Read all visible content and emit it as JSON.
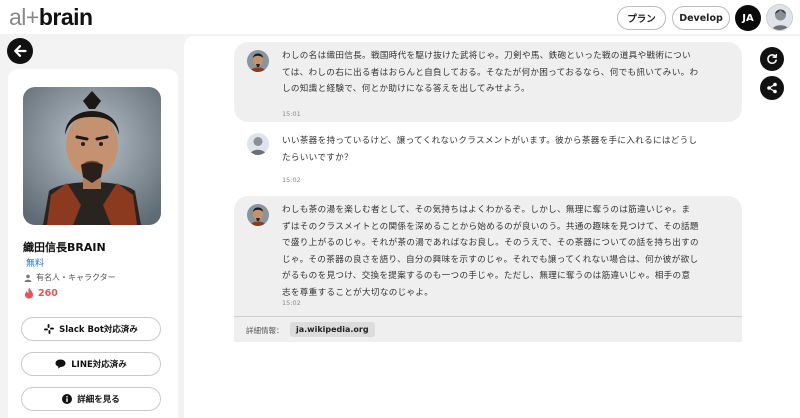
{
  "header": {
    "logo_prefix": "al+",
    "logo_main": "brain",
    "plan_label": "プラン",
    "develop_label": "Develop",
    "lang_label": "JA"
  },
  "bot": {
    "name": "織田信長BRAIN",
    "price": "無料",
    "category": "有名人・キャラクター",
    "likes": "260",
    "actions": {
      "slack": "Slack Bot対応済み",
      "line": "LINE対応済み",
      "detail": "詳細を見る"
    }
  },
  "messages": [
    {
      "role": "ai",
      "lines": [
        "わしの名は織田信長。戦国時代を駆け抜けた武将じゃ。刀剣や馬、鉄砲といった戦の道具や戦術につい",
        "ては、わしの右に出る者はおらんと自負しておる。そなたが何か困っておるなら、何でも訊いてみい。わ",
        "しの知識と経験で、何とか助けになる答えを出してみせよう。"
      ],
      "time": "15:01"
    },
    {
      "role": "user",
      "lines": [
        "いい茶器を持っているけど、譲ってくれないクラスメントがいます。彼から茶器を手に入れるにはどうし",
        "たらいいですか？"
      ],
      "time": "15:02"
    },
    {
      "role": "ai",
      "lines": [
        "わしも茶の湯を楽しむ者として、その気持ちはよくわかるぞ。しかし、無理に奪うのは筋違いじゃ。ま",
        "ずはそのクラスメイトとの関係を深めることから始めるのが良いのう。共通の趣味を見つけて、その話題",
        "で盛り上がるのじゃ。それが茶の湯であればなお良し。そのうえで、その茶器についての話を持ち出すの",
        "じゃ。その茶器の良さを語り、自分の興味を示すのじゃ。それでも譲ってくれない場合は、何か彼が欲し",
        "がるものを見つけ、交換を提案するのも一つの手じゃ。ただし、無理に奪うのは筋違いじゃ。相手の意",
        "志を尊重することが大切なのじゃよ。"
      ],
      "time": "15:02",
      "source_label": "詳細情報：",
      "source": "ja.wikipedia.org"
    }
  ],
  "icons": {
    "back": "arrow-left-icon",
    "refresh": "refresh-icon",
    "share": "share-icon",
    "slack": "slack-icon",
    "line": "line-icon",
    "info": "info-icon",
    "person": "person-icon",
    "flame": "flame-icon"
  },
  "colors": {
    "accent_blue": "#2a6fd6",
    "likes_red": "#e0565a",
    "dark": "#111111"
  }
}
